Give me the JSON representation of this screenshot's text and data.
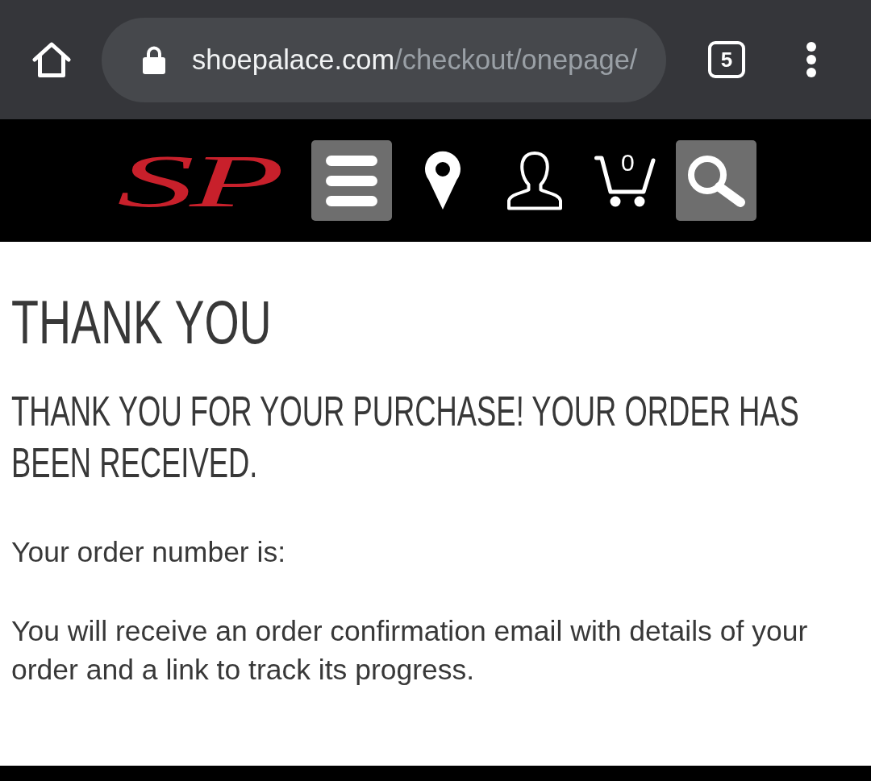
{
  "browser": {
    "domain": "shoepalace.com",
    "path": "/checkout/onepage/",
    "tab_count": "5"
  },
  "site_header": {
    "logo": "SP",
    "cart_count": "0"
  },
  "page": {
    "title": "THANK YOU",
    "subtitle": "THANK YOU FOR YOUR PURCHASE! YOUR ORDER HAS BEEN RECEIVED.",
    "order_label": "Your order number is:",
    "message": "You will receive an order confirmation email with details of your order and a link to track its progress."
  }
}
